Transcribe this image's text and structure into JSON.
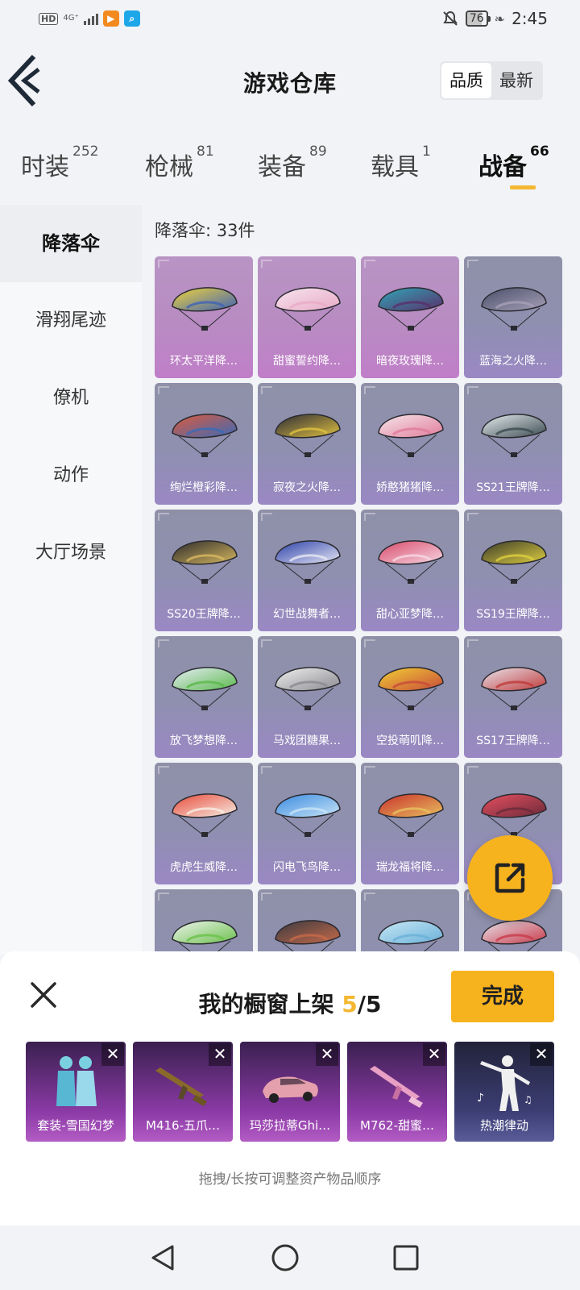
{
  "status_bar": {
    "hd": "HD",
    "network": "4G⁺",
    "sub": "⁴⁶",
    "battery": "76",
    "time": "2:45"
  },
  "header": {
    "title": "游戏仓库",
    "sort_options": [
      "品质",
      "最新"
    ],
    "sort_active": "品质"
  },
  "category_tabs": [
    {
      "label": "时装",
      "count": "252"
    },
    {
      "label": "枪械",
      "count": "81"
    },
    {
      "label": "装备",
      "count": "89"
    },
    {
      "label": "载具",
      "count": "1"
    },
    {
      "label": "战备",
      "count": "66",
      "active": true
    }
  ],
  "sidebar": {
    "items": [
      "降落伞",
      "滑翔尾迹",
      "僚机",
      "动作",
      "大厅场景"
    ],
    "active": "降落伞"
  },
  "content": {
    "count_label": "降落伞: 33件",
    "items": [
      {
        "name": "环太平洋降…",
        "tier": "pink",
        "colors": [
          "#f2d43a",
          "#3e62b8"
        ]
      },
      {
        "name": "甜蜜誓约降…",
        "tier": "pink",
        "colors": [
          "#f6e4ee",
          "#e8aac6"
        ]
      },
      {
        "name": "暗夜玫瑰降…",
        "tier": "pink",
        "colors": [
          "#2fa7b8",
          "#5a2e6a"
        ]
      },
      {
        "name": "蓝海之火降…",
        "tier": "purple",
        "colors": [
          "#4a4f6a",
          "#a8a0b8"
        ]
      },
      {
        "name": "绚烂橙彩降…",
        "tier": "purple",
        "colors": [
          "#e05a3a",
          "#3a6ab8"
        ]
      },
      {
        "name": "寂夜之火降…",
        "tier": "purple",
        "colors": [
          "#2b2b36",
          "#e0c040"
        ]
      },
      {
        "name": "娇憨猪猪降…",
        "tier": "purple",
        "colors": [
          "#f6e8ec",
          "#e07a9a"
        ]
      },
      {
        "name": "SS21王牌降…",
        "tier": "purple",
        "colors": [
          "#e8eef0",
          "#3a4a50"
        ]
      },
      {
        "name": "SS20王牌降…",
        "tier": "purple",
        "colors": [
          "#2a2a2a",
          "#d8b860"
        ]
      },
      {
        "name": "幻世战舞者…",
        "tier": "purple",
        "colors": [
          "#2b40a8",
          "#e8e8f4"
        ]
      },
      {
        "name": "甜心亚梦降…",
        "tier": "purple",
        "colors": [
          "#d84a6a",
          "#f6d8e4"
        ]
      },
      {
        "name": "SS19王牌降…",
        "tier": "purple",
        "colors": [
          "#3a3a2a",
          "#e0d040"
        ]
      },
      {
        "name": "放飞梦想降…",
        "tier": "purple",
        "colors": [
          "#e8eef8",
          "#5ab84a"
        ]
      },
      {
        "name": "马戏团糖果…",
        "tier": "purple",
        "colors": [
          "#f0f0f0",
          "#8a8a90"
        ]
      },
      {
        "name": "空投萌叽降…",
        "tier": "purple",
        "colors": [
          "#f2d034",
          "#c84a3a"
        ]
      },
      {
        "name": "SS17王牌降…",
        "tier": "purple",
        "colors": [
          "#e8e4ec",
          "#c03a3a"
        ]
      },
      {
        "name": "虎虎生威降…",
        "tier": "purple",
        "colors": [
          "#e84a3a",
          "#f6eee4"
        ]
      },
      {
        "name": "闪电飞鸟降…",
        "tier": "purple",
        "colors": [
          "#3a8ae0",
          "#c8e4f6"
        ]
      },
      {
        "name": "瑞龙福将降…",
        "tier": "purple",
        "colors": [
          "#c8302a",
          "#e8c060"
        ]
      },
      {
        "name": "",
        "tier": "purple",
        "colors": [
          "#e85060",
          "#6a2a3a"
        ]
      },
      {
        "name": "",
        "tier": "purple",
        "colors": [
          "#f0f4f0",
          "#6ac04a"
        ]
      },
      {
        "name": "",
        "tier": "purple",
        "colors": [
          "#3a3a40",
          "#c86a4a"
        ]
      },
      {
        "name": "",
        "tier": "purple",
        "colors": [
          "#c8e8f6",
          "#6ab0d8"
        ]
      },
      {
        "name": "",
        "tier": "purple",
        "colors": [
          "#e8e4ec",
          "#c83a4a"
        ]
      }
    ]
  },
  "sheet": {
    "title_prefix": "我的橱窗上架 ",
    "current": "5",
    "total": "/5",
    "done_label": "完成",
    "hint": "拖拽/长按可调整资产物品顺序",
    "close_symbol": "✕",
    "items": [
      {
        "label": "套装-雪国幻梦",
        "style": "purple-grad",
        "icon": "outfit-icon"
      },
      {
        "label": "M416-五爪…",
        "style": "purple-grad",
        "icon": "rifle-icon"
      },
      {
        "label": "玛莎拉蒂Ghi…",
        "style": "purple-grad",
        "icon": "car-icon"
      },
      {
        "label": "M762-甜蜜…",
        "style": "purple-grad",
        "icon": "rifle-pink-icon"
      },
      {
        "label": "热潮律动",
        "style": "dark",
        "icon": "dance-icon"
      }
    ]
  },
  "colors": {
    "accent": "#f7b31e",
    "pink_tier": "#c07ec8",
    "purple_tier": "#9a88c4"
  }
}
